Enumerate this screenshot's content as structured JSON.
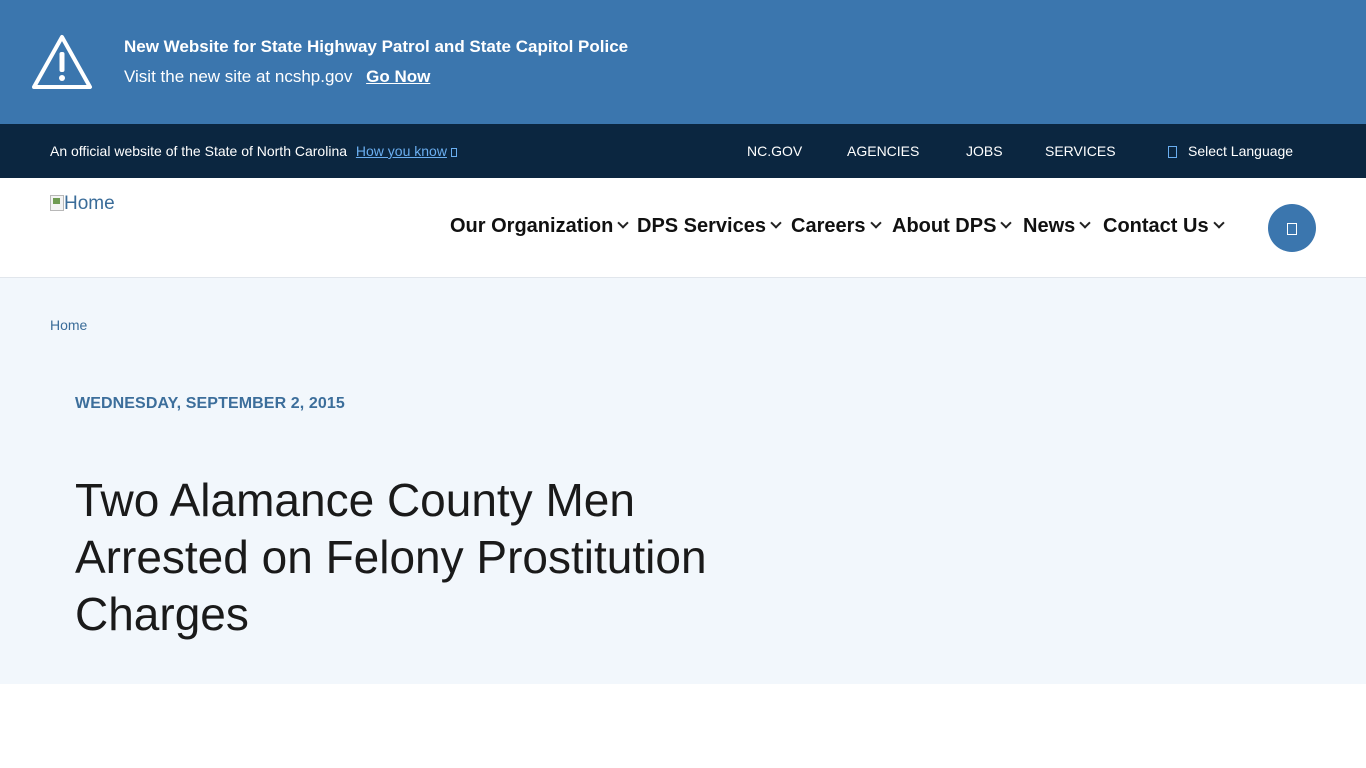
{
  "alert": {
    "title": "New Website for State Highway Patrol and State Capitol Police",
    "text": "Visit the new site at ncshp.gov",
    "link": "Go Now",
    "icon": "warning-icon"
  },
  "official_bar": {
    "message": "An official website of the State of North Carolina",
    "how_you_know": "How you know",
    "links": [
      "NC.GOV",
      "AGENCIES",
      "JOBS",
      "SERVICES"
    ],
    "language": "Select Language"
  },
  "header": {
    "logo_alt": "Home",
    "nav": [
      "Our Organization",
      "DPS Services",
      "Careers",
      "About DPS",
      "News",
      "Contact Us"
    ]
  },
  "hero": {
    "breadcrumb": "Home",
    "date": "WEDNESDAY, SEPTEMBER 2, 2015",
    "headline": "Two Alamance County Men Arrested on Felony Prostitution Charges"
  },
  "colors": {
    "alert_bg": "#3b76ae",
    "official_bg": "#0b2640",
    "hero_bg": "#f2f7fc",
    "link_blue": "#6aaef0"
  }
}
